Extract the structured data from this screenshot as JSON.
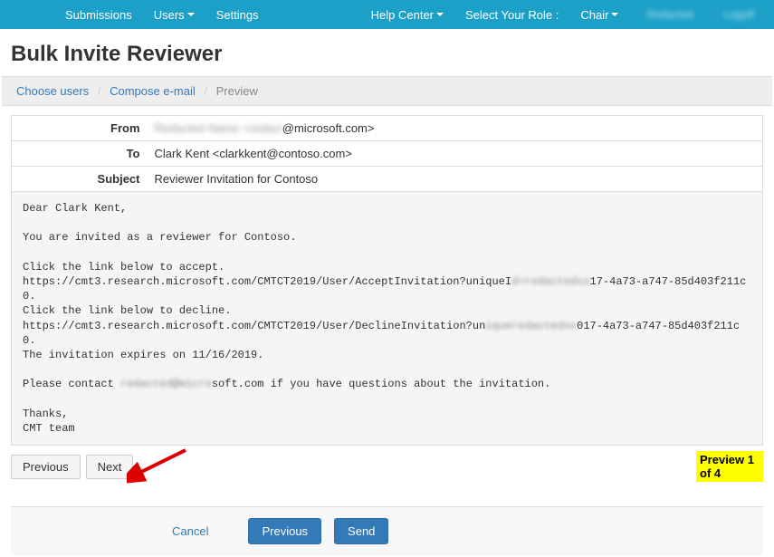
{
  "nav": {
    "submissions": "Submissions",
    "users": "Users",
    "settings": "Settings",
    "helpCenter": "Help Center",
    "selectRole": "Select Your Role :",
    "role": "Chair"
  },
  "title": "Bulk Invite Reviewer",
  "breadcrumbs": {
    "chooseUsers": "Choose users",
    "compose": "Compose e-mail",
    "preview": "Preview"
  },
  "form": {
    "fromLabel": "From",
    "fromValue": "@microsoft.com>",
    "fromBlurred": "Redacted Name <redact",
    "toLabel": "To",
    "toValue": "Clark Kent <clarkkent@contoso.com>",
    "subjectLabel": "Subject",
    "subjectValue": "Reviewer Invitation for Contoso"
  },
  "body": {
    "line1": "Dear Clark Kent,",
    "line2": "You are invited as a reviewer for Contoso.",
    "line3": "Click the link below to accept.",
    "line4a": "https://cmt3.research.microsoft.com/CMTCT2019/User/AcceptInvitation?uniqueI",
    "line4_blur": "d=redactedxx",
    "line4b": "17-4a73-a747-85d403f211c0.",
    "line5": "Click the link below to decline.",
    "line6a": "https://cmt3.research.microsoft.com/CMTCT2019/User/DeclineInvitation?un",
    "line6_blur": "iqueredactedxx",
    "line6b": "017-4a73-a747-85d403f211c0.",
    "line7": "The invitation expires on 11/16/2019.",
    "line8a": "Please contact ",
    "line8_blur": "redacted@micro",
    "line8b": "soft.com if you have questions about the invitation.",
    "line9": "Thanks,",
    "line10": "CMT team"
  },
  "buttons": {
    "previous": "Previous",
    "next": "Next"
  },
  "pagination": "Preview 1 of 4",
  "footer": {
    "cancel": "Cancel",
    "previous": "Previous",
    "send": "Send"
  }
}
